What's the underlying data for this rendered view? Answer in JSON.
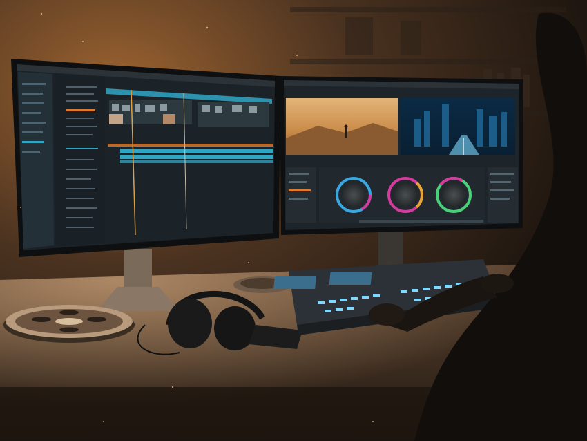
{
  "scene": {
    "description_items": [
      "editing-room",
      "dual-monitor",
      "color-grading",
      "timeline",
      "film-reel",
      "headphones",
      "control-surface",
      "editor-silhouette"
    ]
  },
  "colors": {
    "ambient_warm": "#c9833b",
    "room_dark": "#1a1410",
    "ui_panel": "#1f2a30",
    "ui_accent_teal": "#2fa6c4",
    "ui_accent_orange": "#e07b2e",
    "wheel_blue": "#3aa7e0",
    "wheel_magenta": "#d33c9e",
    "wheel_green": "#4bd07a",
    "key_glow": "#7fd8ff"
  },
  "left_monitor": {
    "content": "timeline-editor",
    "tracks": [
      "video",
      "video",
      "audio",
      "audio",
      "audio"
    ]
  },
  "right_monitor": {
    "content": "color-grading",
    "preview_left": "desert-figure",
    "preview_right": "city-night",
    "wheels": [
      "shadows-wheel",
      "midtones-wheel",
      "highlights-wheel"
    ]
  }
}
